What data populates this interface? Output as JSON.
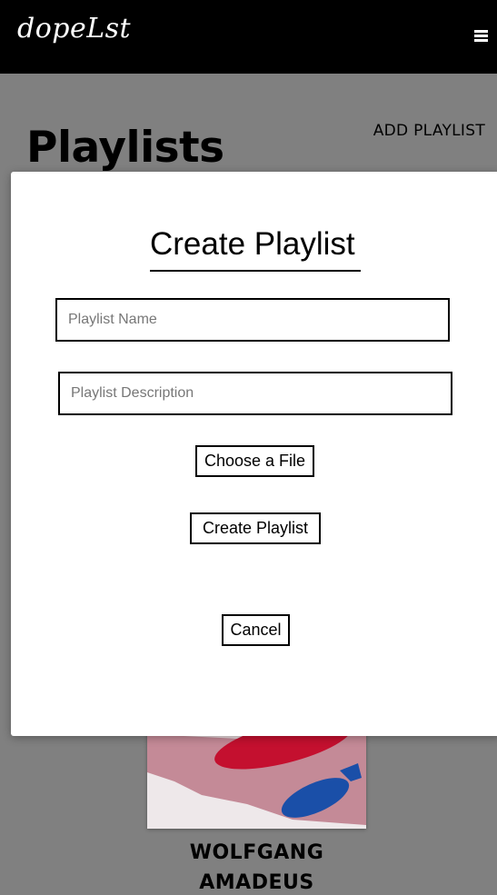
{
  "app": {
    "logo_text": "dopeLst"
  },
  "header": {
    "menu_icon": "hamburger-menu-icon"
  },
  "page": {
    "title": "Playlists",
    "add_playlist_label": "ADD PLAYLIST"
  },
  "album": {
    "artist": "WOLFGANG AMADEUS",
    "accent_colors": [
      "#c48a97",
      "#c4102f",
      "#1a4fa8"
    ]
  },
  "modal": {
    "title": "Create Playlist",
    "name_placeholder": "Playlist Name",
    "name_value": "",
    "description_placeholder": "Playlist Description",
    "description_value": "",
    "choose_file_label": "Choose a File",
    "create_label": "Create Playlist",
    "cancel_label": "Cancel"
  },
  "colors": {
    "header_bg": "#000000",
    "overlay": "#808080",
    "modal_bg": "#ffffff"
  }
}
